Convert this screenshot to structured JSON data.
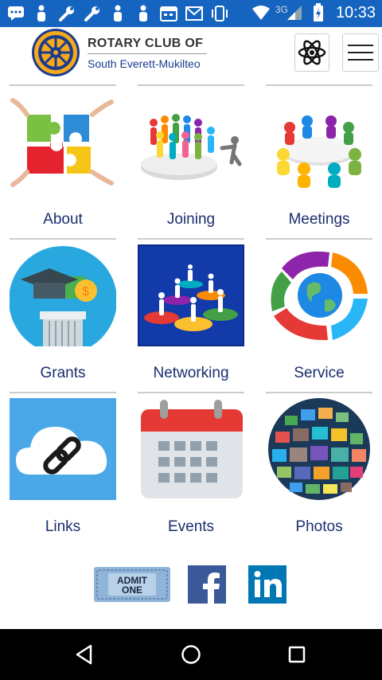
{
  "status_bar": {
    "time": "10:33",
    "network": "3G",
    "left_icons": [
      "chat-icon",
      "person-icon",
      "wrench-icon",
      "wrench-icon",
      "person-icon",
      "person-icon",
      "calendar-icon",
      "mail-icon",
      "vibrate-icon"
    ],
    "right_icons": [
      "wifi-icon",
      "signal-icon",
      "battery-icon"
    ]
  },
  "header": {
    "title_line1": "ROTARY CLUB OF",
    "title_line2": "South Everett-Mukilteo",
    "logo": "rotary-wheel-logo",
    "atom_button": "atom-icon",
    "menu_button": "hamburger-menu-icon"
  },
  "tiles": [
    {
      "label": "About",
      "image": "puzzle-pieces"
    },
    {
      "label": "Joining",
      "image": "people-group-join"
    },
    {
      "label": "Meetings",
      "image": "round-table-meeting"
    },
    {
      "label": "Grants",
      "image": "graduation-money"
    },
    {
      "label": "Networking",
      "image": "people-network"
    },
    {
      "label": "Service",
      "image": "hands-around-globe"
    },
    {
      "label": "Links",
      "image": "cloud-link"
    },
    {
      "label": "Events",
      "image": "calendar"
    },
    {
      "label": "Photos",
      "image": "photo-globe"
    }
  ],
  "social": {
    "ticket_text": "ADMIT\nONE",
    "facebook": "facebook-icon",
    "linkedin": "linkedin-icon"
  },
  "nav": [
    "back-icon",
    "home-icon",
    "recents-icon"
  ],
  "colors": {
    "status_bar": "#1565c0",
    "label_text": "#1a2e6e",
    "facebook": "#3b5998",
    "linkedin": "#0077b5"
  }
}
